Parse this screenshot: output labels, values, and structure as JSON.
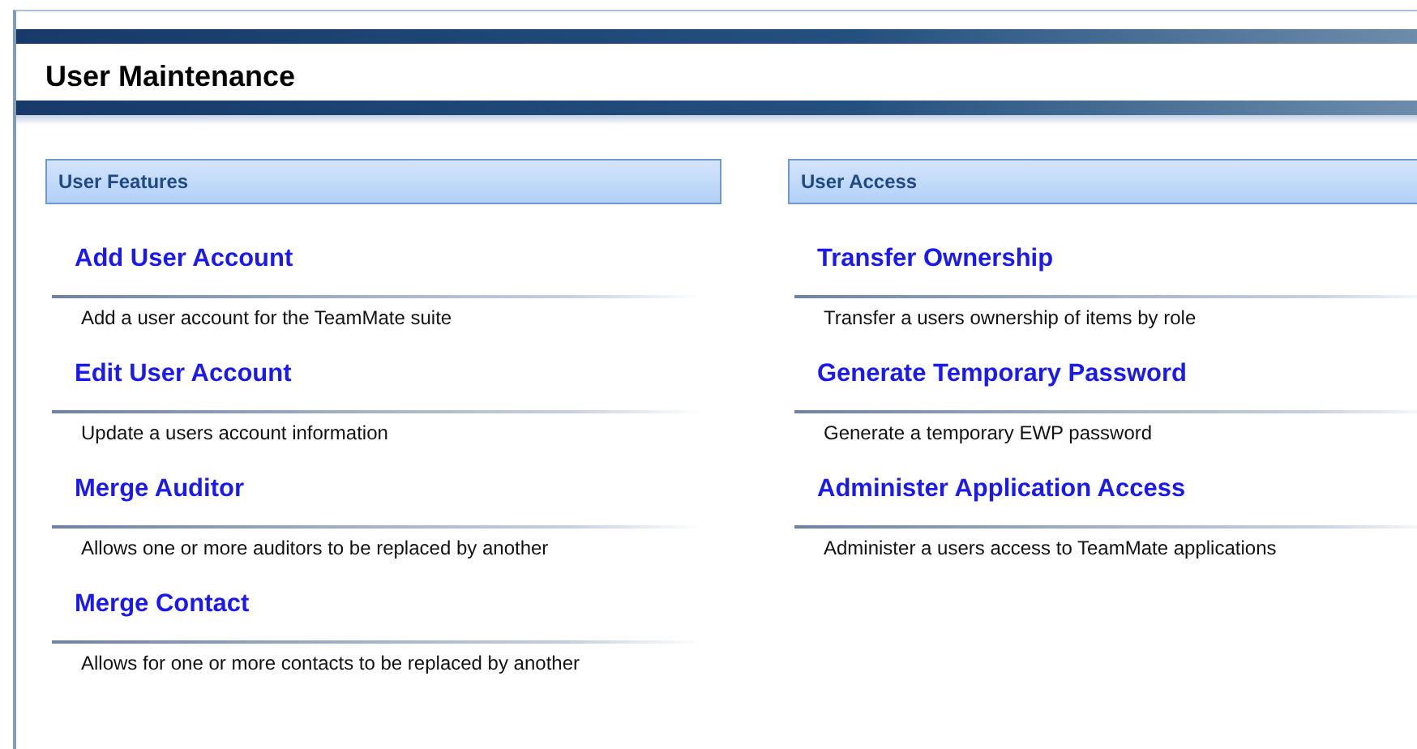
{
  "title": "User Maintenance",
  "sections": [
    {
      "heading": "User Features",
      "items": [
        {
          "label": "Add User Account",
          "description": "Add a user account for the TeamMate suite"
        },
        {
          "label": "Edit User Account",
          "description": "Update a users account information"
        },
        {
          "label": "Merge Auditor",
          "description": "Allows one or more auditors to be replaced by another"
        },
        {
          "label": "Merge Contact",
          "description": "Allows for one or more contacts to be replaced by another"
        }
      ]
    },
    {
      "heading": "User Access",
      "items": [
        {
          "label": "Transfer Ownership",
          "description": "Transfer a users ownership of items by role"
        },
        {
          "label": "Generate Temporary Password",
          "description": "Generate a temporary EWP password"
        },
        {
          "label": "Administer Application Access",
          "description": "Administer a users access to TeamMate applications"
        }
      ]
    }
  ]
}
